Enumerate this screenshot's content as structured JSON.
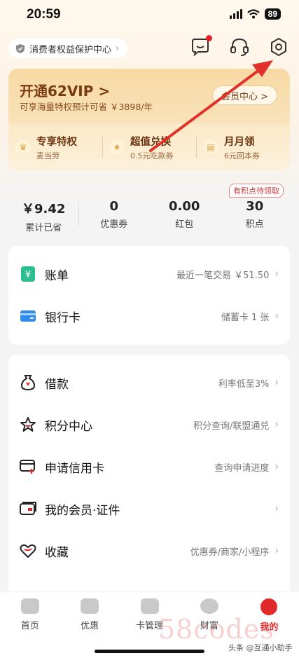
{
  "status": {
    "time": "20:59",
    "battery": "89"
  },
  "header": {
    "protect_label": "消费者权益保护中心",
    "icons": [
      "message-icon",
      "headset-icon",
      "settings-gear-icon"
    ]
  },
  "vip": {
    "title": "开通62VIP >",
    "subtitle": "可享海量特权预计可省 ￥3898/年",
    "button_label": "会员中心 >",
    "perks": [
      {
        "title": "专享特权",
        "sub": "麦当劳",
        "icon": "crown-icon"
      },
      {
        "title": "超值兑换",
        "sub": "0.5元吃款券",
        "icon": "star-icon"
      },
      {
        "title": "月月领",
        "sub": "6元回本券",
        "icon": "ticket-icon"
      }
    ]
  },
  "points_badge": "有积点待领取",
  "stats": [
    {
      "value": "￥9.42",
      "label": "累计已省"
    },
    {
      "value": "0",
      "label": "优惠券"
    },
    {
      "value": "0.00",
      "label": "红包"
    },
    {
      "value": "30",
      "label": "积点"
    }
  ],
  "card1": [
    {
      "label": "账单",
      "right": "最近一笔交易 ￥51.50",
      "icon": "bill-icon"
    },
    {
      "label": "银行卡",
      "right": "储蓄卡 1 张",
      "icon": "bank-card-icon"
    }
  ],
  "card2": [
    {
      "label": "借款",
      "right": "利率低至3%",
      "icon": "loan-bag-icon"
    },
    {
      "label": "积分中心",
      "right": "积分查询/联盟通兑",
      "icon": "points-star-icon"
    },
    {
      "label": "申请信用卡",
      "right": "查询申请进度",
      "icon": "credit-card-icon"
    },
    {
      "label": "我的会员·证件",
      "right": "",
      "icon": "membership-card-icon"
    },
    {
      "label": "收藏",
      "right": "优惠券/商家/小程序",
      "icon": "heart-icon"
    }
  ],
  "nav": [
    {
      "label": "首页",
      "icon": "home-icon"
    },
    {
      "label": "优惠",
      "icon": "discount-icon"
    },
    {
      "label": "卡管理",
      "icon": "card-manage-icon"
    },
    {
      "label": "财富",
      "icon": "wealth-icon"
    },
    {
      "label": "我的",
      "icon": "profile-icon",
      "active": true
    }
  ],
  "watermark": {
    "main": "58codes",
    "sub": "头条 @互通小助手"
  },
  "colors": {
    "accent_red": "#e02a2a",
    "vip_brown": "#7a3a12",
    "bill_green": "#2bbf8f",
    "bank_blue": "#2e8cf0"
  }
}
